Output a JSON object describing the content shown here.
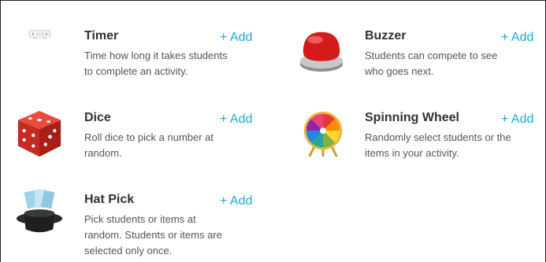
{
  "add_label": "+ Add",
  "accent_color": "#1ea8d8",
  "tools": [
    {
      "title": "Timer",
      "description_lines": [
        "Time how long it takes students",
        "to complete an activity."
      ],
      "icon": "timer-icon"
    },
    {
      "title": "Buzzer",
      "description_lines": [
        "Students can compete to see",
        "who goes next."
      ],
      "icon": "buzzer-icon"
    },
    {
      "title": "Dice",
      "description_lines": [
        "Roll dice to pick a number at",
        "random."
      ],
      "icon": "dice-icon"
    },
    {
      "title": "Spinning Wheel",
      "description_lines": [
        "Randomly select students or the",
        "items in your activity."
      ],
      "icon": "spinning-wheel-icon"
    },
    {
      "title": "Hat Pick",
      "description_lines": [
        "Pick students or items at",
        "random. Students or items are",
        "selected only once."
      ],
      "icon": "hat-icon"
    }
  ],
  "timer_digits": [
    "0",
    "1",
    "3",
    "0"
  ]
}
